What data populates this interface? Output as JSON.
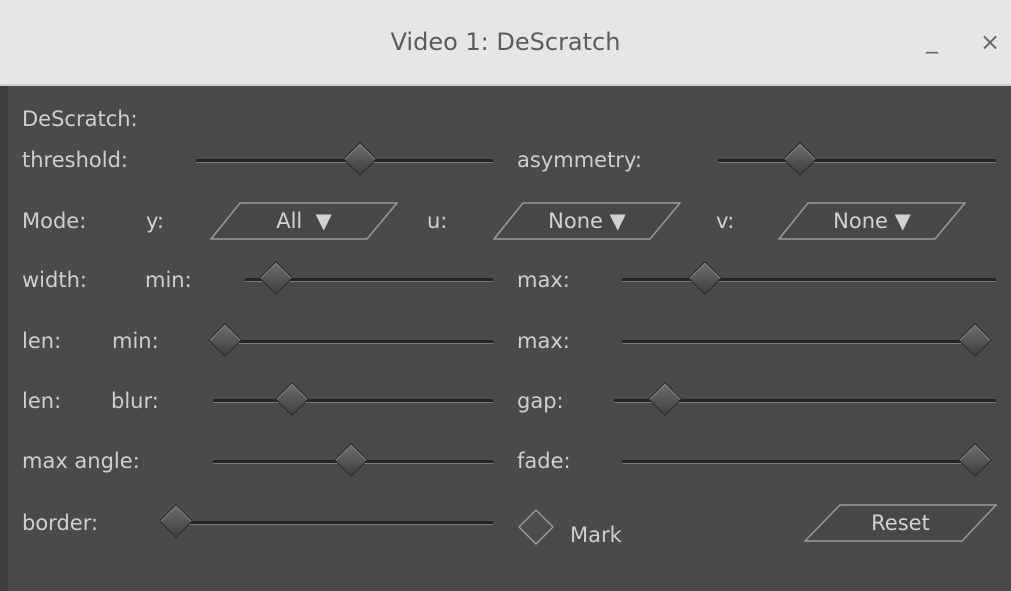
{
  "window": {
    "title": "Video 1: DeScratch",
    "minimize_glyph": "_",
    "close_glyph": "×"
  },
  "panel": {
    "heading": "DeScratch:",
    "threshold": {
      "label": "threshold:",
      "value": 0.55
    },
    "asymmetry": {
      "label": "asymmetry:",
      "value": 0.29
    },
    "mode": {
      "label": "Mode:",
      "y": {
        "label": "y:",
        "value": "All"
      },
      "u": {
        "label": "u:",
        "value": "None"
      },
      "v": {
        "label": "v:",
        "value": "None"
      }
    },
    "width": {
      "label": "width:",
      "min_label": "min:",
      "min_value": 0.12,
      "max_label": "max:",
      "max_value": 0.22
    },
    "len": {
      "label": "len:",
      "min_label": "min:",
      "min_value": 0.0,
      "max_label": "max:",
      "max_value": 1.0
    },
    "len_blur": {
      "label": "len:",
      "blur_label": "blur:",
      "blur_value": 0.28,
      "gap_label": "gap:",
      "gap_value": 0.13
    },
    "max_angle": {
      "label": "max angle:",
      "value": 0.49
    },
    "fade": {
      "label": "fade:",
      "value": 1.0
    },
    "border": {
      "label": "border:",
      "value": 0.0
    },
    "mark": {
      "label": "Mark",
      "checked": false
    },
    "reset": {
      "label": "Reset"
    },
    "dropdown_arrow": "▼"
  }
}
